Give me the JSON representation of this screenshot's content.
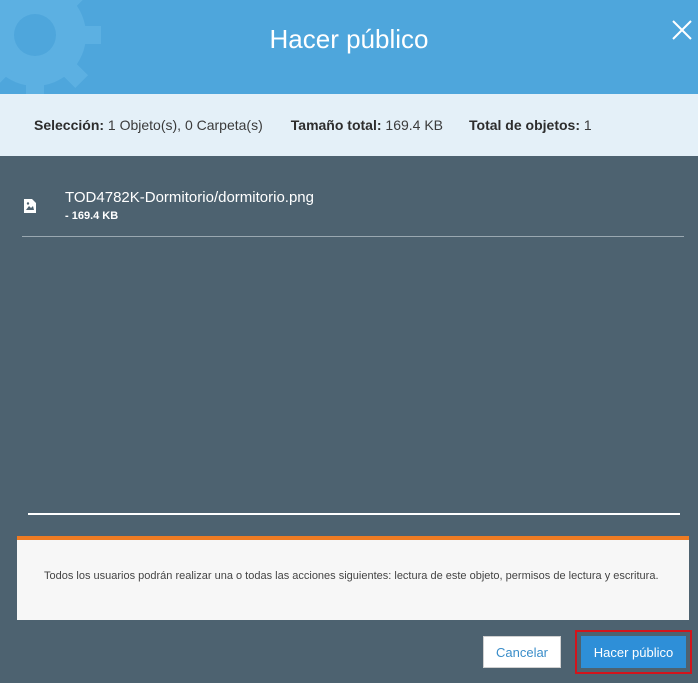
{
  "dialog": {
    "title": "Hacer público"
  },
  "summary": {
    "selection_label": "Selección:",
    "selection_value": "1 Objeto(s), 0 Carpeta(s)",
    "size_label": "Tamaño total:",
    "size_value": "169.4 KB",
    "count_label": "Total de objetos:",
    "count_value": "1"
  },
  "files": [
    {
      "name": "TOD4782K-Dormitorio/dormitorio.png",
      "size": "- 169.4 KB",
      "icon": "image-file-icon"
    }
  ],
  "notice": {
    "text": "Todos los usuarios podrán realizar una o todas las acciones siguientes: lectura de este objeto, permisos de lectura y escritura.",
    "accent_color": "#ef7b22"
  },
  "buttons": {
    "cancel": "Cancelar",
    "confirm": "Hacer público"
  },
  "colors": {
    "header": "#4ea6dc",
    "body": "#4d6270",
    "primary": "#2e8fd8",
    "highlight": "#d3141b"
  }
}
